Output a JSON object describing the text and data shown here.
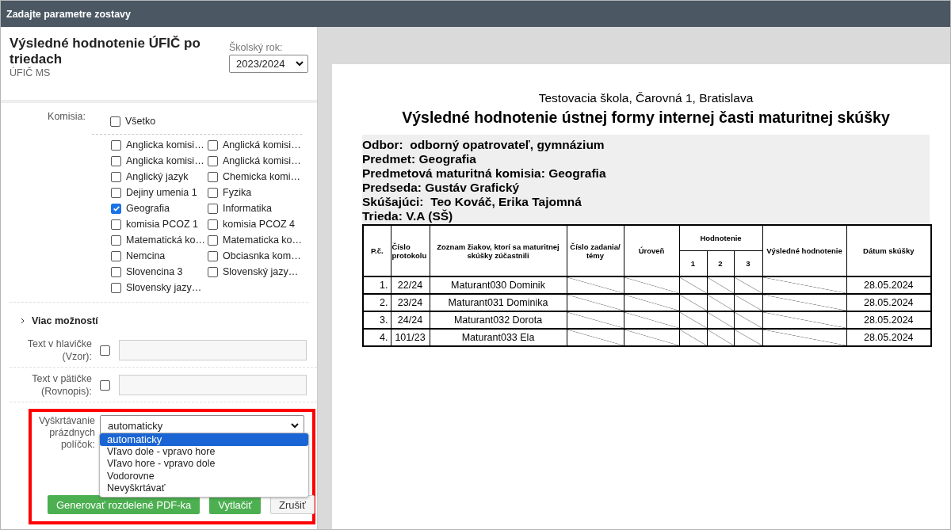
{
  "window": {
    "title": "Zadajte parametre zostavy"
  },
  "panel": {
    "title": "Výsledné hodnotenie ÚFIČ po triedach",
    "subtitle": "ÚFIČ MS",
    "year": {
      "label": "Školský rok:",
      "value": "2023/2024"
    },
    "komisia": {
      "label": "Komisia:",
      "all": {
        "label": "Všetko",
        "checked": false
      },
      "items": [
        {
          "label": "Anglicka komisi…",
          "checked": false
        },
        {
          "label": "Anglická komisi…",
          "checked": false
        },
        {
          "label": "Anglicka komisi…",
          "checked": false
        },
        {
          "label": "Anglická komisi…",
          "checked": false
        },
        {
          "label": "Anglický jazyk",
          "checked": false
        },
        {
          "label": "Chemicka komi…",
          "checked": false
        },
        {
          "label": "Dejiny umenia 1",
          "checked": false
        },
        {
          "label": "Fyzika",
          "checked": false
        },
        {
          "label": "Geografia",
          "checked": true
        },
        {
          "label": "Informatika",
          "checked": false
        },
        {
          "label": "komisia PCOZ 1",
          "checked": false
        },
        {
          "label": "komisia PCOZ 4",
          "checked": false
        },
        {
          "label": "Matematická ko…",
          "checked": false
        },
        {
          "label": "Matematicka ko…",
          "checked": false
        },
        {
          "label": "Nemcina",
          "checked": false
        },
        {
          "label": "Obciasnka kom…",
          "checked": false
        },
        {
          "label": "Slovencina 3",
          "checked": false
        },
        {
          "label": "Slovenský jazy…",
          "checked": false
        },
        {
          "label": "Slovensky jazy…",
          "checked": false
        }
      ]
    },
    "more": {
      "label": "Viac možností",
      "expanded": false
    },
    "fields": [
      {
        "label": "Text v hlavičke (Vzor):",
        "checked": false
      },
      {
        "label": "Text v pätičke (Rovnopis):",
        "checked": false
      }
    ],
    "strike": {
      "label": "Vyškrtávanie prázdnych políčok:",
      "value": "automaticky",
      "highlighted": true,
      "options": [
        {
          "label": "automaticky",
          "selected": true
        },
        {
          "label": "Vľavo dole - vpravo hore",
          "selected": false
        },
        {
          "label": "Vľavo hore - vpravo dole",
          "selected": false
        },
        {
          "label": "Vodorovne",
          "selected": false
        },
        {
          "label": "Nevyškrtávať",
          "selected": false
        }
      ]
    },
    "buttons": [
      {
        "label": "Generovať rozdelené PDF-ka",
        "kind": "primary"
      },
      {
        "label": "Vytlačiť",
        "kind": "primary"
      },
      {
        "label": "Zrušiť",
        "kind": "secondary"
      }
    ]
  },
  "report": {
    "school": "Testovacia škola, Čarovná 1, Bratislava",
    "title": "Výsledné hodnotenie ústnej formy internej časti maturitnej skúšky",
    "info": [
      "Odbor:  odborný opatrovateľ, gymnázium",
      "Predmet: Geografia",
      "Predmetová maturitná komisia: Geografia",
      "Predseda: Gustáv Grafický",
      "Skúšajúci:  Teo Kováč, Erika Tajomná",
      "Trieda: V.A (SŠ)"
    ],
    "table": {
      "columns": {
        "no": "P.č.",
        "protocol": "Číslo protokolu",
        "students": "Zoznam žiakov, ktorí sa maturitnej skúšky zúčastnili",
        "task": "Číslo zadania/ témy",
        "level": "Úroveň",
        "grades": "Hodnotenie",
        "grade_parts": [
          "1",
          "2",
          "3"
        ],
        "result": "Výsledné hodnotenie",
        "date": "Dátum skúšky"
      },
      "rows": [
        {
          "no": "1.",
          "protocol": "22/24",
          "name": "Maturant030 Dominik",
          "date": "28.05.2024"
        },
        {
          "no": "2.",
          "protocol": "23/24",
          "name": "Maturant031 Dominika",
          "date": "28.05.2024"
        },
        {
          "no": "3.",
          "protocol": "24/24",
          "name": "Maturant032 Dorota",
          "date": "28.05.2024"
        },
        {
          "no": "4.",
          "protocol": "101/23",
          "name": "Maturant033 Ela",
          "date": "28.05.2024"
        }
      ]
    }
  }
}
